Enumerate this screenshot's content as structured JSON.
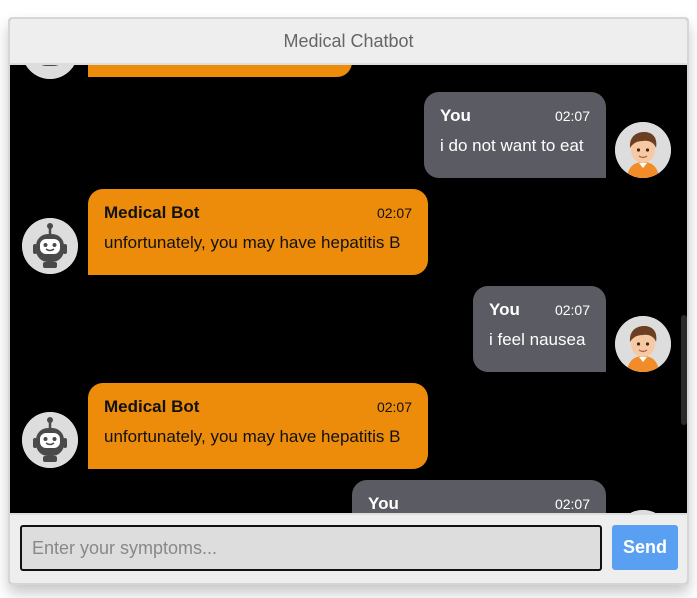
{
  "header": {
    "title": "Medical Chatbot"
  },
  "messages": [
    {
      "sender": "You",
      "time": "02:07",
      "text": "i do not want to eat"
    },
    {
      "sender": "Medical Bot",
      "time": "02:07",
      "text": "unfortunately, you may have hepatitis B"
    },
    {
      "sender": "You",
      "time": "02:07",
      "text": "i feel nausea"
    },
    {
      "sender": "Medical Bot",
      "time": "02:07",
      "text": "unfortunately, you may have hepatitis B"
    },
    {
      "sender": "You",
      "time": "02:07",
      "text": ""
    }
  ],
  "input": {
    "placeholder": "Enter your symptoms...",
    "value": ""
  },
  "send_button": {
    "label": "Send"
  },
  "colors": {
    "bot_bubble": "#ec8c0a",
    "user_bubble": "#5b5b63",
    "send_button": "#5aa0f2",
    "chat_background": "#000000"
  },
  "icons": {
    "bot_avatar": "robot-icon",
    "user_avatar": "user-icon"
  }
}
